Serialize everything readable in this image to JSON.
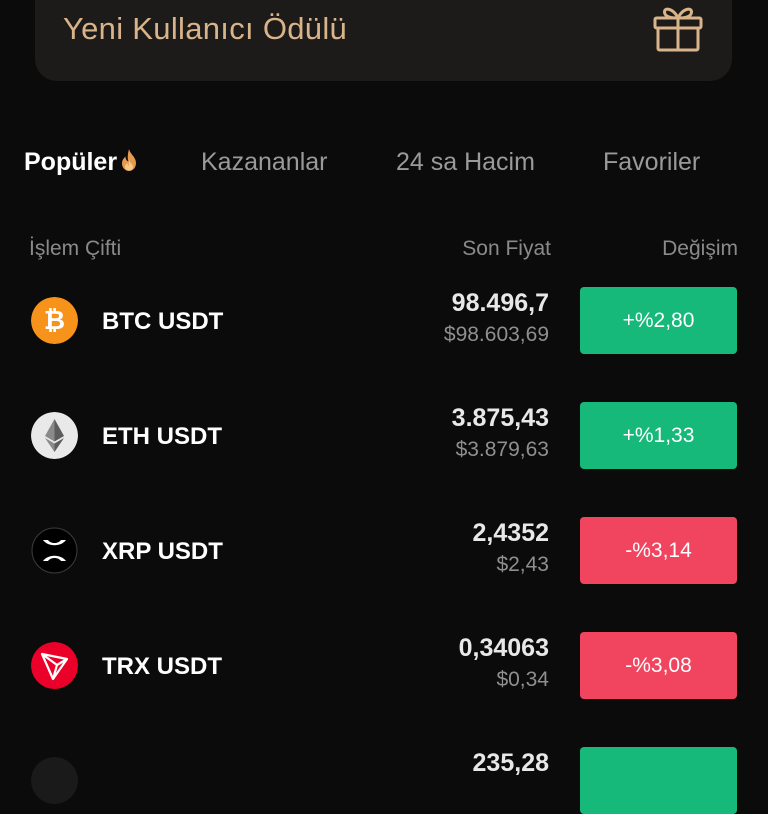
{
  "banner": {
    "title": "Yeni Kullanıcı Ödülü",
    "icon": "gift-icon",
    "accent_color": "#d9b48a"
  },
  "tabs": [
    {
      "label": "Popüler",
      "active": true,
      "icon": "fire-icon"
    },
    {
      "label": "Kazananlar",
      "active": false
    },
    {
      "label": "24 sa Hacim",
      "active": false
    },
    {
      "label": "Favoriler",
      "active": false
    }
  ],
  "columns": {
    "pair": "İşlem Çifti",
    "last_price": "Son Fiyat",
    "change": "Değişim"
  },
  "colors": {
    "up": "#16b979",
    "down": "#f0445f"
  },
  "rows": [
    {
      "pair": "BTC USDT",
      "icon": "bitcoin-icon",
      "price": "98.496,7",
      "price_usd": "$98.603,69",
      "change": "+%2,80",
      "direction": "up"
    },
    {
      "pair": "ETH USDT",
      "icon": "ethereum-icon",
      "price": "3.875,43",
      "price_usd": "$3.879,63",
      "change": "+%1,33",
      "direction": "up"
    },
    {
      "pair": "XRP USDT",
      "icon": "xrp-icon",
      "price": "2,4352",
      "price_usd": "$2,43",
      "change": "-%3,14",
      "direction": "down"
    },
    {
      "pair": "TRX USDT",
      "icon": "tron-icon",
      "price": "0,34063",
      "price_usd": "$0,34",
      "change": "-%3,08",
      "direction": "down"
    },
    {
      "pair": "",
      "icon": "coin-icon",
      "price": "235,28",
      "price_usd": "",
      "change": "",
      "direction": "up"
    }
  ]
}
